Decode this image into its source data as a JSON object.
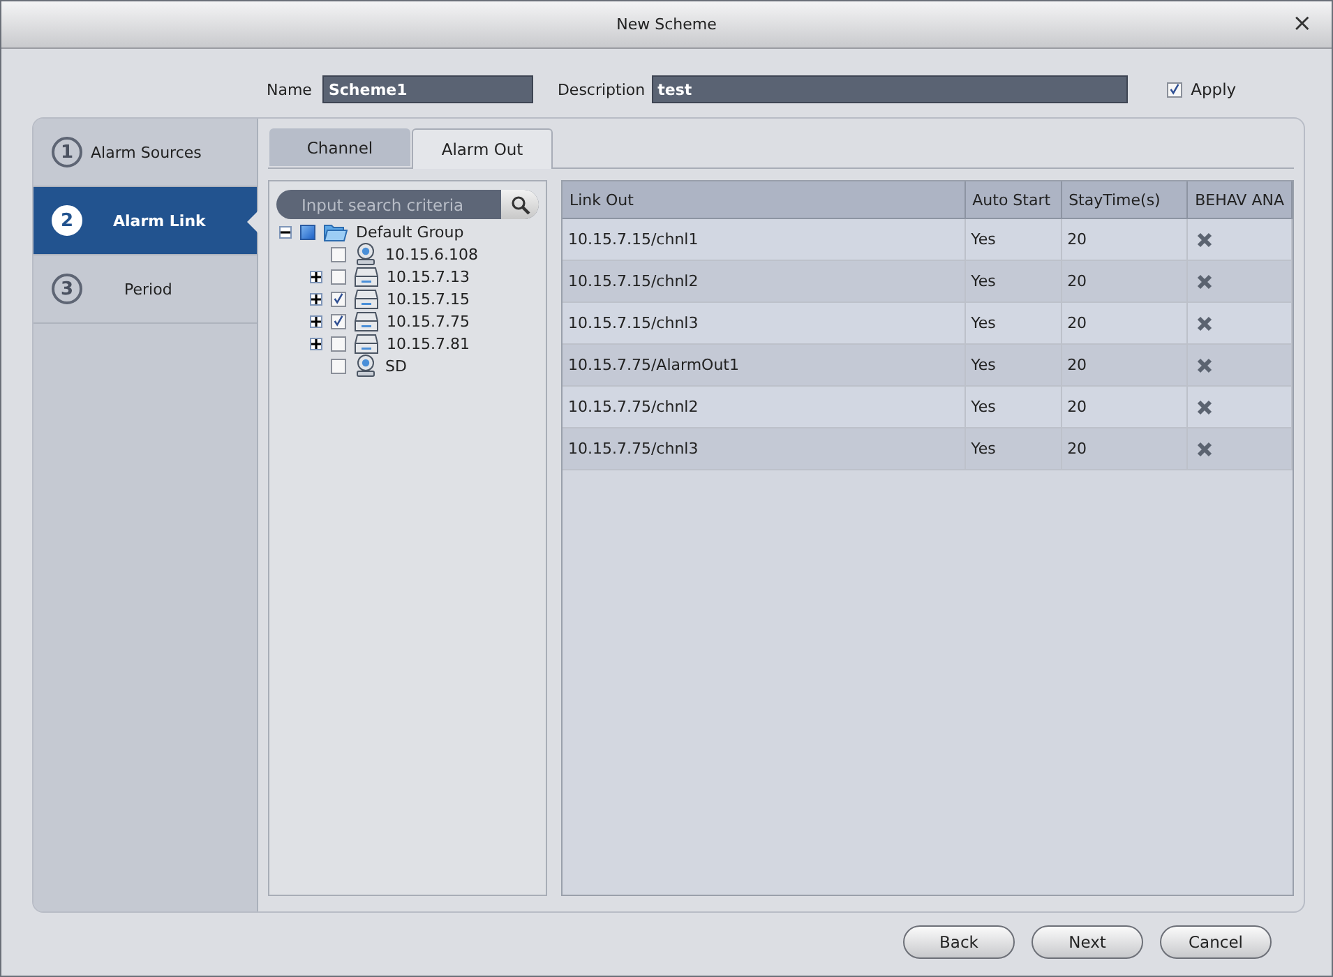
{
  "window": {
    "title": "New Scheme",
    "close": "×"
  },
  "form": {
    "name_label": "Name",
    "name_value": "Scheme1",
    "description_label": "Description",
    "description_value": "test",
    "apply_label": "Apply",
    "apply_checked": true
  },
  "steps": [
    {
      "number": "1",
      "label": "Alarm Sources",
      "selected": false
    },
    {
      "number": "2",
      "label": "Alarm Link",
      "selected": true
    },
    {
      "number": "3",
      "label": "Period",
      "selected": false
    }
  ],
  "tabs": [
    {
      "label": "Channel",
      "selected": false
    },
    {
      "label": "Alarm Out",
      "selected": true
    }
  ],
  "search": {
    "placeholder": "Input search criteria"
  },
  "tree": [
    {
      "label": "Default Group",
      "kind": "group",
      "expanded": true,
      "checked": false,
      "partial": true,
      "children": [
        {
          "label": "10.15.6.108",
          "kind": "camera",
          "checked": false
        },
        {
          "label": "10.15.7.13",
          "kind": "device",
          "expanded": false,
          "checked": false
        },
        {
          "label": "10.15.7.15",
          "kind": "device",
          "expanded": false,
          "checked": true
        },
        {
          "label": "10.15.7.75",
          "kind": "device",
          "expanded": false,
          "checked": true
        },
        {
          "label": "10.15.7.81",
          "kind": "device",
          "expanded": false,
          "checked": false
        },
        {
          "label": "SD",
          "kind": "camera",
          "checked": false
        }
      ]
    }
  ],
  "table": {
    "columns": [
      "Link Out",
      "Auto Start",
      "StayTime(s)",
      "BEHAV ANA"
    ],
    "rows": [
      [
        "10.15.7.15/chnl1",
        "Yes",
        "20"
      ],
      [
        "10.15.7.15/chnl2",
        "Yes",
        "20"
      ],
      [
        "10.15.7.15/chnl3",
        "Yes",
        "20"
      ],
      [
        "10.15.7.75/AlarmOut1",
        "Yes",
        "20"
      ],
      [
        "10.15.7.75/chnl2",
        "Yes",
        "20"
      ],
      [
        "10.15.7.75/chnl3",
        "Yes",
        "20"
      ]
    ]
  },
  "buttons": [
    "Back",
    "Next",
    "Cancel"
  ]
}
